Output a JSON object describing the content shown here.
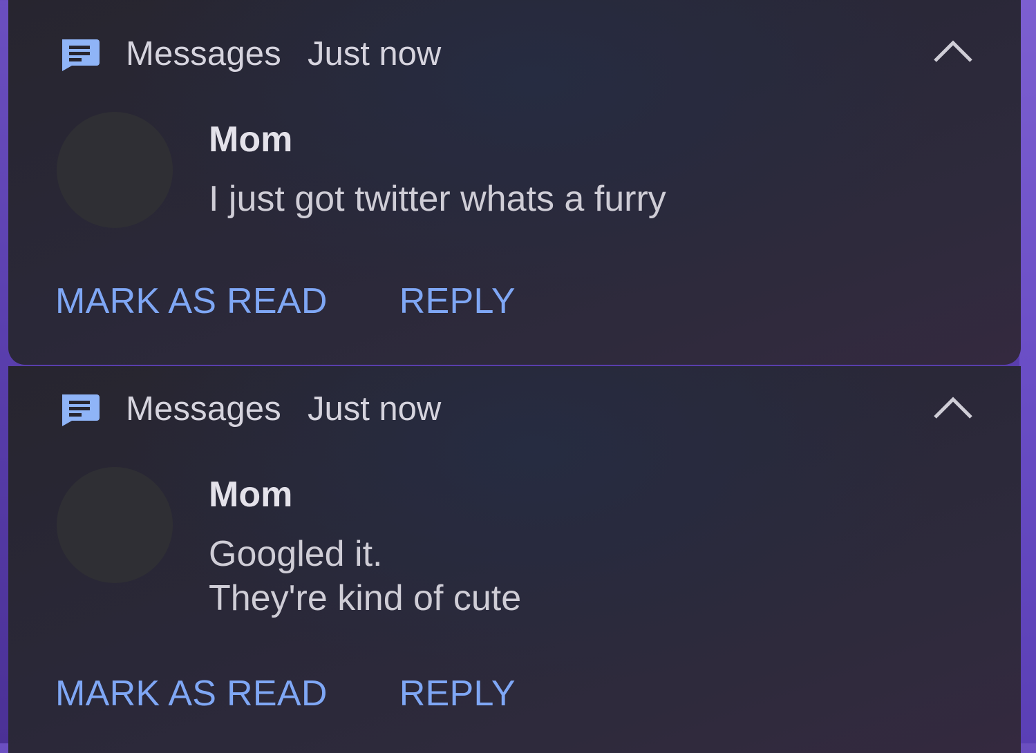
{
  "notifications": [
    {
      "app_name": "Messages",
      "timestamp": "Just now",
      "sender": "Mom",
      "message_lines": [
        "I just got twitter whats a furry"
      ],
      "actions": {
        "mark_as_read": "MARK AS READ",
        "reply": "REPLY"
      }
    },
    {
      "app_name": "Messages",
      "timestamp": "Just now",
      "sender": "Mom",
      "message_lines": [
        "Googled it.",
        "They're kind of cute"
      ],
      "actions": {
        "mark_as_read": "MARK AS READ",
        "reply": "REPLY"
      }
    }
  ],
  "icons": {
    "app_icon": "messages-icon",
    "collapse_icon": "chevron-up-icon"
  },
  "colors": {
    "accent": "#7fa7f5",
    "app_icon": "#8fb4f7",
    "card_background": "#2a2838",
    "avatar_placeholder": "#2f2f34",
    "wallpaper": "#6b4fc0"
  }
}
